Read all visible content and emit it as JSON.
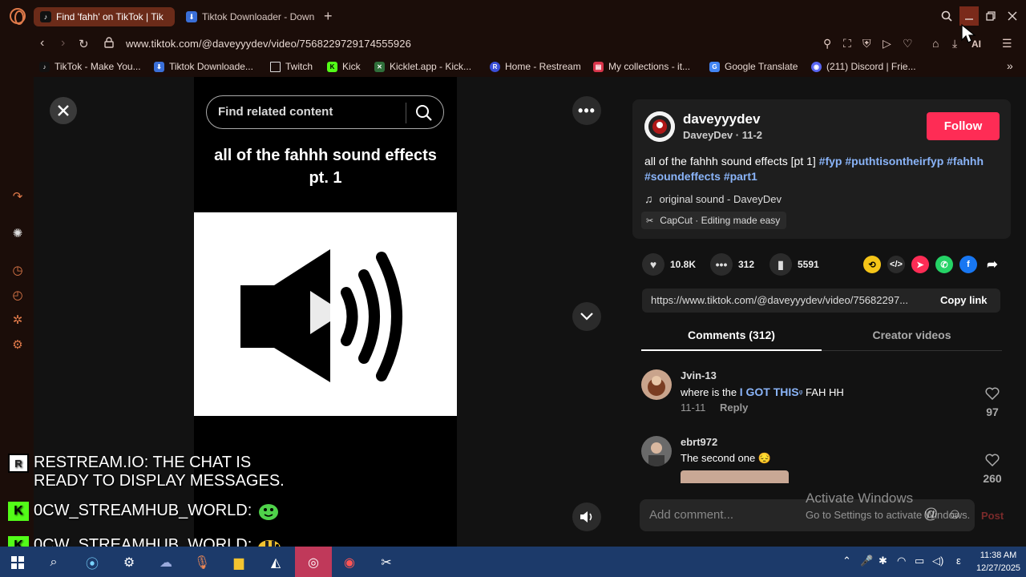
{
  "browser": {
    "tabs": [
      {
        "label": "Find 'fahh' on TikTok | Tik",
        "active": true
      },
      {
        "label": "Tiktok Downloader - Down",
        "active": false
      }
    ],
    "new_tab": "+",
    "url": "www.tiktok.com/@daveyyydev/video/7568229729174555926",
    "bookmarks": [
      {
        "label": "TikTok - Make You...",
        "icon": "tiktok-icon"
      },
      {
        "label": "Tiktok Downloade...",
        "icon": "download-icon"
      },
      {
        "label": "Twitch",
        "icon": "document-icon"
      },
      {
        "label": "Kick",
        "icon": "kick-icon"
      },
      {
        "label": "Kicklet.app - Kick...",
        "icon": "kicklet-icon"
      },
      {
        "label": "Home - Restream",
        "icon": "restream-icon"
      },
      {
        "label": "My collections - it...",
        "icon": "collections-icon"
      },
      {
        "label": "Google Translate",
        "icon": "translate-icon"
      },
      {
        "label": "(211) Discord | Frie...",
        "icon": "discord-icon"
      }
    ],
    "ai_label": "AI"
  },
  "video": {
    "search_placeholder": "Find related content",
    "title_line1": "all of the fahhh sound effects",
    "title_line2": "pt. 1",
    "more": "•••"
  },
  "chat": [
    {
      "source": "restream",
      "badge": "R",
      "user": "RESTREAM.IO:",
      "message_line1": " THE CHAT IS",
      "message_line2": "READY TO DISPLAY MESSAGES."
    },
    {
      "source": "kick",
      "badge": "K",
      "user": "0CW_STREAMHUB_WORLD:",
      "emote": "green-blob-emote"
    },
    {
      "source": "kick",
      "badge": "K",
      "user": "0CW_STREAMHUB_WORLD:",
      "emote": "bee-emote"
    }
  ],
  "author": {
    "username": "daveyyydev",
    "nickname": "DaveyDev · 11-2",
    "follow_label": "Follow"
  },
  "description": {
    "text": "all of the fahhh sound effects [pt 1] ",
    "tags": [
      "#fyp",
      "#puthtisontheirfyp",
      "#fahhh",
      "#soundeffects",
      "#part1"
    ]
  },
  "music": "original sound - DaveyDev",
  "capcut": "CapCut · Editing made easy",
  "stats": {
    "likes": "10.8K",
    "comments": "312",
    "saves": "5591"
  },
  "share_link": {
    "url": "https://www.tiktok.com/@daveyyydev/video/75682297...",
    "copy_label": "Copy link"
  },
  "panel_tabs": {
    "comments": "Comments (312)",
    "creator": "Creator videos"
  },
  "comments": [
    {
      "user": "Jvin-13",
      "text_before": "where is the ",
      "highlight": "I GOT THIS",
      "search_mark": "ᵠ",
      "text_after": " FAH HH",
      "date": "11-11",
      "reply": "Reply",
      "likes": "97"
    },
    {
      "user": "ebrt972",
      "text_before": "The second one ",
      "emoji": "😔",
      "likes": "260"
    }
  ],
  "add_comment": {
    "placeholder": "Add comment...",
    "post_label": "Post"
  },
  "watermark": {
    "title": "Activate Windows",
    "sub": "Go to Settings to activate Windows."
  },
  "taskbar": {
    "time": "11:38 AM",
    "date": "12/27/2025",
    "lang": "ε"
  }
}
